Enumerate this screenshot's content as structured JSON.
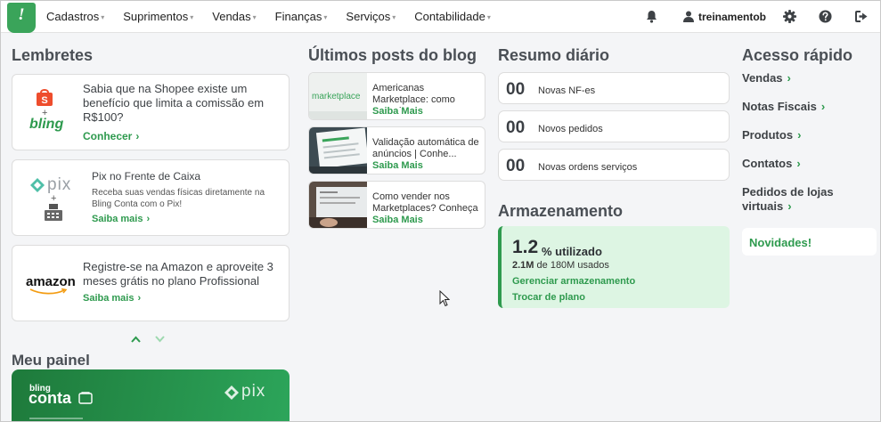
{
  "nav": {
    "logo": "!",
    "menu": [
      {
        "label": "Cadastros"
      },
      {
        "label": "Suprimentos"
      },
      {
        "label": "Vendas"
      },
      {
        "label": "Finanças"
      },
      {
        "label": "Serviços"
      },
      {
        "label": "Contabilidade"
      }
    ],
    "username": "treinamentob",
    "icons": [
      "bell-icon",
      "user-icon",
      "gear-icon",
      "help-icon",
      "logout-icon"
    ]
  },
  "lembretes": {
    "title": "Lembretes",
    "cards": [
      {
        "text": "Sabia que na Shopee existe um benefício que limita a comissão em R$100?",
        "link": "Conhecer",
        "logo_text": "bling"
      },
      {
        "heading": "Pix no Frente de Caixa",
        "text": "Receba suas vendas físicas diretamente na Bling Conta com o Pix!",
        "link": "Saiba mais",
        "logo_text": "pix"
      },
      {
        "text": "Registre-se na Amazon e aproveite 3 meses grátis no plano Profissional",
        "link": "Saiba mais",
        "logo_text": "amazon"
      }
    ]
  },
  "blog": {
    "title": "Últimos posts do blog",
    "posts": [
      {
        "title": "Americanas Marketplace: como anunciar e...",
        "more": "Saiba Mais",
        "thumb_text": "marketplace"
      },
      {
        "title": "Validação automática de anúncios | Conhe...",
        "more": "Saiba Mais"
      },
      {
        "title": "Como vender nos Marketplaces? Conheça as...",
        "more": "Saiba Mais"
      }
    ]
  },
  "resumo": {
    "title": "Resumo diário",
    "items": [
      {
        "value": "00",
        "label": "Novas NF-es"
      },
      {
        "value": "00",
        "label": "Novos pedidos"
      },
      {
        "value": "00",
        "label": "Novas ordens serviços"
      }
    ]
  },
  "armazenamento": {
    "title": "Armazenamento",
    "percent": "1.2",
    "percent_label": "% utilizado",
    "used": "2.1M",
    "used_rest": "de 180M usados",
    "manage_link": "Gerenciar armazenamento",
    "plan_link": "Trocar de plano"
  },
  "acesso": {
    "title": "Acesso rápido",
    "items": [
      {
        "label": "Vendas"
      },
      {
        "label": "Notas Fiscais"
      },
      {
        "label": "Produtos"
      },
      {
        "label": "Contatos"
      },
      {
        "label": "Pedidos de lojas virtuais"
      }
    ],
    "novidades": "Novidades!"
  },
  "painel": {
    "title": "Meu painel",
    "brand_small": "bling",
    "brand_big": "conta",
    "pix": "pix"
  },
  "colors": {
    "accent": "#2e9a4e",
    "storage_bg": "#ddf5e3"
  }
}
